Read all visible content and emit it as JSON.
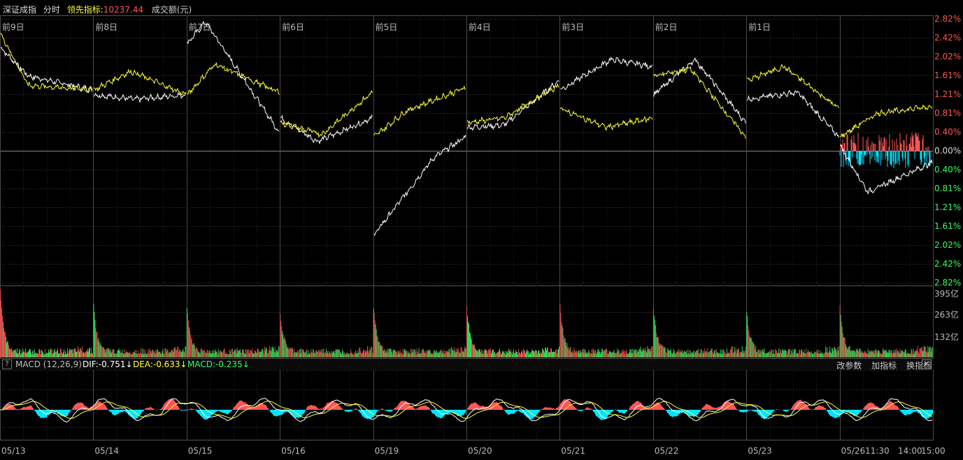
{
  "header": {
    "index_name": "深证成指",
    "mode": "分时",
    "lead_label": "领先指标:",
    "lead_value": "10237.44",
    "volume_label": "成交额(元)"
  },
  "colors": {
    "price_line": "#ffffff",
    "lead_line": "#ffff33",
    "up": "#ff5555",
    "down": "#33ff66",
    "hist_down": "#00e5ff",
    "grid": "#3a3a3a",
    "frame": "#555555"
  },
  "macd_header": {
    "help": "?",
    "name": "MACD (12,26,9)",
    "dif": "DIF:-0.751↓",
    "dea": "DEA:-0.633↓",
    "macd": "MACD:-0.235↓",
    "buttons": [
      "改参数",
      "加指标",
      "换指标"
    ],
    "close": "✕"
  },
  "chart_data": [
    {
      "type": "line",
      "panel": "price",
      "day_labels": [
        "前9日",
        "前8日",
        "前7日",
        "前6日",
        "前5日",
        "前4日",
        "前3日",
        "前2日",
        "前1日"
      ],
      "y_ticks": [
        "2.82%",
        "2.42%",
        "2.02%",
        "1.61%",
        "1.21%",
        "0.81%",
        "0.40%",
        "0.00%",
        "0.40%",
        "0.81%",
        "1.21%",
        "1.61%",
        "2.02%",
        "2.42%",
        "2.82%"
      ],
      "ylim": [
        -2.82,
        2.82
      ],
      "series": [
        {
          "name": "深证成指",
          "day_endpoints": [
            [
              2.2,
              1.3
            ],
            [
              1.2,
              1.2
            ],
            [
              2.3,
              0.4
            ],
            [
              0.7,
              0.7
            ],
            [
              -1.8,
              0.3
            ],
            [
              0.5,
              1.5
            ],
            [
              1.3,
              1.8
            ],
            [
              1.2,
              0.6
            ],
            [
              1.1,
              0.3
            ],
            [
              0.1,
              -0.25
            ]
          ],
          "day_pivots": [
            0.3,
            0.45,
            0.2,
            0.4,
            0.65,
            0.4,
            0.55,
            0.45,
            0.55,
            0.3
          ],
          "day_extremes": [
            1.6,
            1.1,
            2.75,
            0.2,
            -0.15,
            0.55,
            1.95,
            1.95,
            1.25,
            -0.88
          ]
        },
        {
          "name": "领先指标",
          "day_endpoints": [
            [
              2.5,
              1.3
            ],
            [
              1.3,
              1.2
            ],
            [
              1.2,
              1.25
            ],
            [
              0.6,
              1.25
            ],
            [
              0.3,
              1.35
            ],
            [
              0.6,
              1.4
            ],
            [
              0.9,
              0.7
            ],
            [
              1.6,
              0.3
            ],
            [
              1.5,
              0.9
            ],
            [
              0.3,
              0.95
            ]
          ],
          "day_pivots": [
            0.3,
            0.4,
            0.3,
            0.45,
            0.35,
            0.4,
            0.5,
            0.4,
            0.4,
            0.4
          ],
          "day_extremes": [
            1.4,
            1.7,
            1.85,
            0.35,
            0.85,
            0.7,
            0.5,
            1.75,
            1.8,
            0.8
          ]
        }
      ]
    },
    {
      "type": "bar",
      "panel": "volume",
      "y_ticks": [
        "395亿",
        "263亿",
        "132亿"
      ],
      "ylim": [
        0,
        395
      ],
      "open_peaks": [
        380,
        270,
        270,
        230,
        265,
        265,
        270,
        260,
        245,
        260
      ],
      "base_level": 35
    },
    {
      "type": "line",
      "panel": "macd",
      "x_labels": [
        "05/13",
        "05/14",
        "05/15",
        "05/16",
        "05/19",
        "05/20",
        "05/21",
        "05/22",
        "05/23",
        "05/26",
        "11:30",
        "14:00",
        "15:00"
      ],
      "series": [
        {
          "name": "DIF",
          "value": -0.751
        },
        {
          "name": "DEA",
          "value": -0.633
        },
        {
          "name": "MACD",
          "value": -0.235
        }
      ]
    }
  ]
}
